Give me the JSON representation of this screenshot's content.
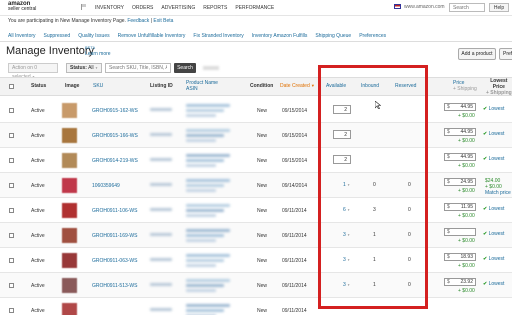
{
  "topnav": {
    "logo_line1": "amazon",
    "logo_line2": "seller central",
    "menu": [
      "INVENTORY",
      "ORDERS",
      "ADVERTISING",
      "REPORTS",
      "PERFORMANCE"
    ],
    "site": "www.amazon.com",
    "search_placeholder": "Search",
    "help_label": "Help"
  },
  "notice": {
    "text": "You are participating in New Manage Inventory Page.",
    "feedback": "Feedback",
    "exit_beta": "Exit Beta"
  },
  "tabs": [
    "All Inventory",
    "Suppressed",
    "Quality Issues",
    "Remove Unfulfillable Inventory",
    "Fix Stranded Inventory",
    "Inventory Amazon Fulfills",
    "Shipping Queue",
    "Preferences"
  ],
  "page": {
    "title": "Manage Inventory",
    "beta": "BETA",
    "learn_more": "Learn more",
    "add_product": "Add a product",
    "preferences": "Pref"
  },
  "filters": {
    "actions_label": "Action on 0 selected",
    "status_label": "Status:",
    "status_value": "All",
    "search_placeholder": "Search SKU, Title, ISBN, ASIN",
    "search_button": "Search"
  },
  "columns": {
    "status": "Status",
    "image": "Image",
    "sku": "SKU",
    "listing_id": "Listing ID",
    "product_name": "Product Name",
    "asin": "ASIN",
    "condition": "Condition",
    "date_created": "Date Created",
    "available": "Available",
    "inbound": "Inbound",
    "reserved": "Reserved",
    "price": "Price",
    "price_sub": "+ Shipping",
    "lowest": "Lowest",
    "lowest_price": "Price",
    "lowest_sub": "+ Shipping"
  },
  "rows": [
    {
      "status": "Active",
      "sku": "GROH0915-162-WS",
      "listing_id": "",
      "condition": "New",
      "date": "09/15/2014",
      "available": "2",
      "available_type": "input",
      "inbound": "",
      "reserved": "",
      "price": "44.95",
      "shipping": "+ $0.00",
      "lowest": "Lowest",
      "thumb_color": "#c89a6a"
    },
    {
      "status": "Active",
      "sku": "GROH0915-166-WS",
      "listing_id": "",
      "condition": "New",
      "date": "09/15/2014",
      "available": "2",
      "available_type": "input",
      "inbound": "",
      "reserved": "",
      "price": "44.95",
      "shipping": "+ $0.00",
      "lowest": "Lowest",
      "thumb_color": "#a8763e"
    },
    {
      "status": "Active",
      "sku": "GROH0914-219-WS",
      "listing_id": "",
      "condition": "New",
      "date": "09/15/2014",
      "available": "2",
      "available_type": "input",
      "inbound": "",
      "reserved": "",
      "price": "44.95",
      "shipping": "+ $0.00",
      "lowest": "Lowest",
      "thumb_color": "#b28a58"
    },
    {
      "status": "Active",
      "sku": "1060359649",
      "listing_id": "",
      "condition": "New",
      "date": "09/14/2014",
      "available": "1",
      "available_type": "link",
      "inbound": "0",
      "reserved": "0",
      "price": "24.95",
      "shipping": "+ $0.00",
      "lowest_price": "$24.00",
      "lowest_ship": "+ $0.00",
      "lowest": "Match price",
      "thumb_color": "#c0384a"
    },
    {
      "status": "Active",
      "sku": "GROH0911-106-WS",
      "listing_id": "",
      "condition": "New",
      "date": "09/11/2014",
      "available": "6",
      "available_type": "link",
      "inbound": "3",
      "reserved": "0",
      "price": "11.95",
      "shipping": "+ $0.00",
      "lowest": "Lowest",
      "thumb_color": "#b03030"
    },
    {
      "status": "Active",
      "sku": "GROH0911-169-WS",
      "listing_id": "",
      "condition": "New",
      "date": "09/11/2014",
      "available": "3",
      "available_type": "link",
      "inbound": "1",
      "reserved": "0",
      "price": "",
      "shipping": "+ $0.00",
      "lowest": "Lowest",
      "thumb_color": "#a05040"
    },
    {
      "status": "Active",
      "sku": "GROH0911-063-WS",
      "listing_id": "",
      "condition": "New",
      "date": "09/11/2014",
      "available": "3",
      "available_type": "link",
      "inbound": "1",
      "reserved": "0",
      "price": "18.93",
      "shipping": "+ $0.00",
      "lowest": "Lowest",
      "thumb_color": "#983838"
    },
    {
      "status": "Active",
      "sku": "GROH0911-513-WS",
      "listing_id": "",
      "condition": "New",
      "date": "09/11/2014",
      "available": "3",
      "available_type": "link",
      "inbound": "1",
      "reserved": "0",
      "price": "23.92",
      "shipping": "+ $0.00",
      "lowest": "Lowest",
      "thumb_color": "#8a5a5a"
    },
    {
      "status": "Active",
      "sku": "",
      "listing_id": "",
      "condition": "New",
      "date": "09/11/2014",
      "available": "",
      "available_type": "link",
      "inbound": "",
      "reserved": "",
      "price": "",
      "shipping": "",
      "lowest": "",
      "thumb_color": "#b04848"
    }
  ],
  "colors": {
    "highlight": "#d42020",
    "link": "#1a6a9a",
    "sorted": "#e07000",
    "lowest_green": "#2a9a2a"
  }
}
